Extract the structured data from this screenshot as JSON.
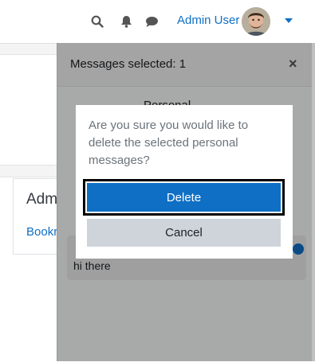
{
  "navbar": {
    "user_name": "Admin User",
    "icons": [
      "search-icon",
      "bell-icon",
      "comment-icon",
      "chevron-down-icon"
    ],
    "accent_color": "#0f6fc5"
  },
  "page": {
    "block_title": "Adm",
    "block_link": "Bookr"
  },
  "drawer": {
    "header_text": "Messages selected: 1",
    "close_symbol": "×",
    "contact_name": "Personal",
    "message_text": "hi there"
  },
  "dialog": {
    "message": "Are you sure you would like to delete the selected personal messages?",
    "delete_label": "Delete",
    "cancel_label": "Cancel",
    "delete_color": "#0f6fc5",
    "cancel_color": "#ced4da"
  }
}
